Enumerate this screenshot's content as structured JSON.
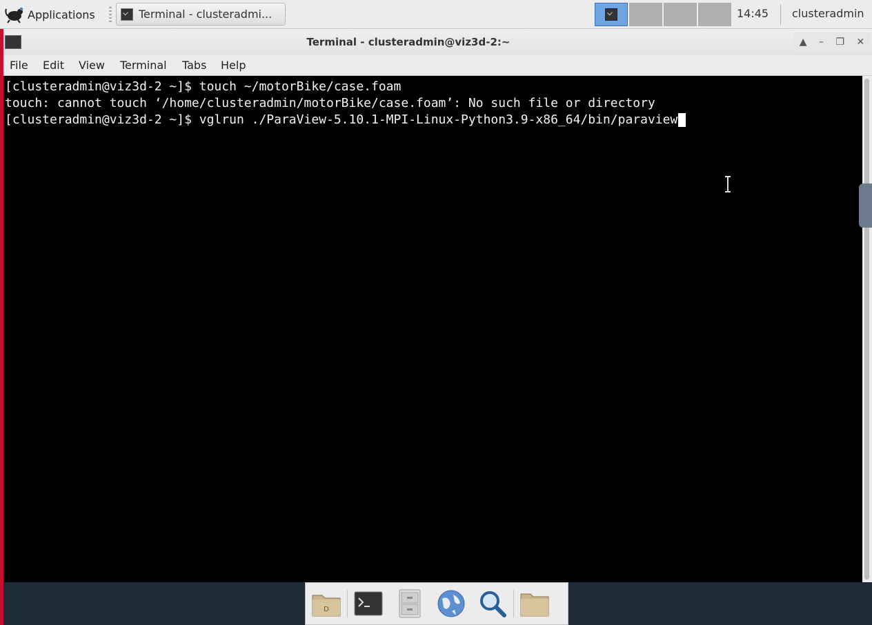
{
  "panel": {
    "applications_label": "Applications",
    "task_title": "Terminal - clusteradmi...",
    "clock": "14:45",
    "user": "clusteradmin"
  },
  "window": {
    "title": "Terminal - clusteradmin@viz3d-2:~",
    "menu": [
      "File",
      "Edit",
      "View",
      "Terminal",
      "Tabs",
      "Help"
    ]
  },
  "terminal": {
    "lines": [
      "[clusteradmin@viz3d-2 ~]$ touch ~/motorBike/case.foam",
      "touch: cannot touch ‘/home/clusteradmin/motorBike/case.foam’: No such file or directory",
      "[clusteradmin@viz3d-2 ~]$ vglrun ./ParaView-5.10.1-MPI-Linux-Python3.9-x86_64/bin/paraview"
    ]
  },
  "dock": {
    "items": [
      "home-folder-icon",
      "terminal-icon",
      "file-cabinet-icon",
      "web-browser-icon",
      "search-icon",
      "folder-icon"
    ]
  },
  "colors": {
    "terminal_bg": "#000000",
    "terminal_fg": "#f2f2f2",
    "active_workspace": "#6ea4e0",
    "left_edge": "#c8102e"
  }
}
